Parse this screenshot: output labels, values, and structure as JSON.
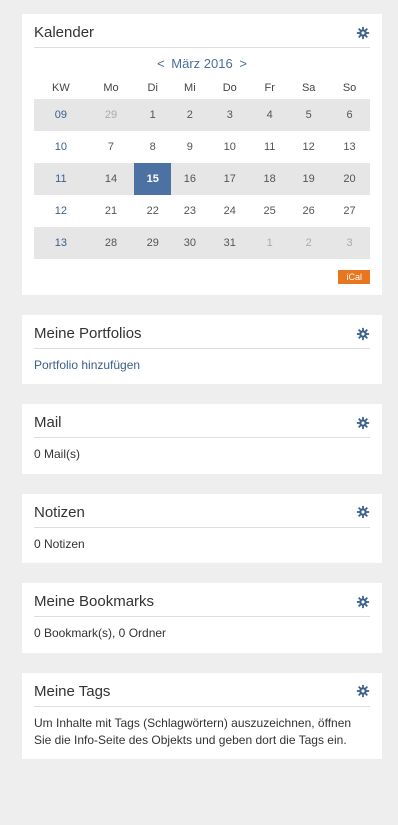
{
  "calendar": {
    "title": "Kalender",
    "month_label": "März 2016",
    "prev": "<",
    "next": ">",
    "headers": [
      "KW",
      "Mo",
      "Di",
      "Mi",
      "Do",
      "Fr",
      "Sa",
      "So"
    ],
    "weeks": [
      {
        "kw": "09",
        "days": [
          "29",
          "1",
          "2",
          "3",
          "4",
          "5",
          "6"
        ]
      },
      {
        "kw": "10",
        "days": [
          "7",
          "8",
          "9",
          "10",
          "11",
          "12",
          "13"
        ]
      },
      {
        "kw": "11",
        "days": [
          "14",
          "15",
          "16",
          "17",
          "18",
          "19",
          "20"
        ]
      },
      {
        "kw": "12",
        "days": [
          "21",
          "22",
          "23",
          "24",
          "25",
          "26",
          "27"
        ]
      },
      {
        "kw": "13",
        "days": [
          "28",
          "29",
          "30",
          "31",
          "1",
          "2",
          "3"
        ]
      }
    ],
    "today": "15",
    "ical_label": "iCal"
  },
  "portfolios": {
    "title": "Meine Portfolios",
    "link": "Portfolio hinzufügen"
  },
  "mail": {
    "title": "Mail",
    "text": "0 Mail(s)"
  },
  "notes": {
    "title": "Notizen",
    "text": "0 Notizen"
  },
  "bookmarks": {
    "title": "Meine Bookmarks",
    "text": "0 Bookmark(s), 0 Ordner"
  },
  "tags": {
    "title": "Meine Tags",
    "text": "Um Inhalte mit Tags (Schlagwörtern) auszuzeichnen, öffnen Sie die Info-Seite des Objekts und geben dort die Tags ein."
  },
  "colors": {
    "accent": "#4b72a3",
    "link": "#3a5f8a",
    "ical": "#e8761e"
  }
}
